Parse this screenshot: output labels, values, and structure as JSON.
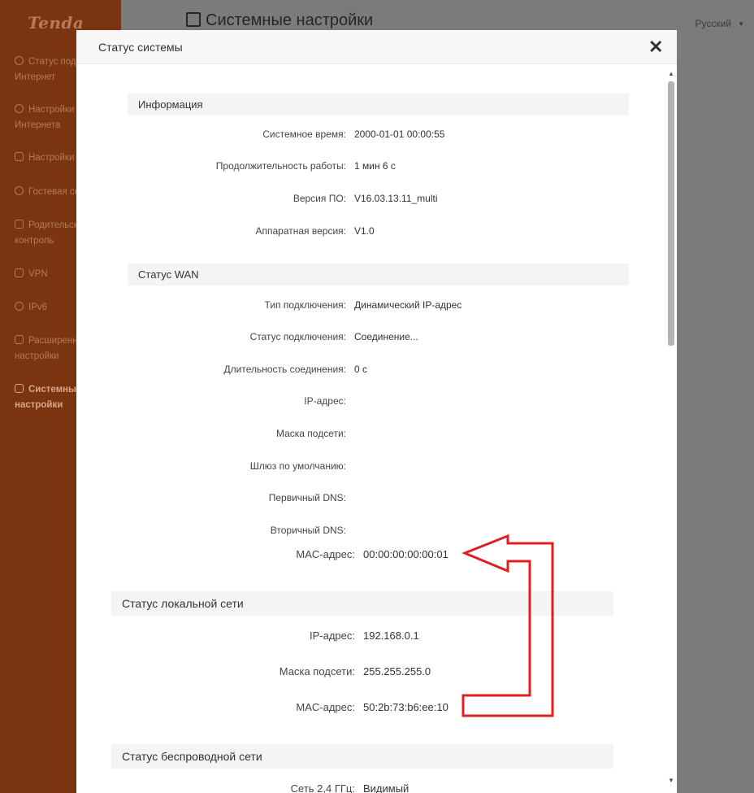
{
  "app": {
    "logo": "Tenda",
    "page_title": "Системные настройки",
    "language": "Русский"
  },
  "sidebar": {
    "items": [
      {
        "label_line1": "Статус подключения",
        "label_line2": "Интернет"
      },
      {
        "label_line1": "Настройки",
        "label_line2": "Интернета"
      },
      {
        "label_line1": "Настройки Wi-Fi",
        "label_line2": ""
      },
      {
        "label_line1": "Гостевая сеть",
        "label_line2": ""
      },
      {
        "label_line1": "Родительский",
        "label_line2": "контроль"
      },
      {
        "label_line1": "VPN",
        "label_line2": ""
      },
      {
        "label_line1": "IPv6",
        "label_line2": ""
      },
      {
        "label_line1": "Расширенные",
        "label_line2": "настройки"
      },
      {
        "label_line1": "Системные",
        "label_line2": "настройки"
      }
    ]
  },
  "modal": {
    "title": "Статус системы",
    "close_label": "✕",
    "info": {
      "header": "Информация",
      "rows": [
        {
          "label": "Системное время:",
          "value": "2000-01-01 00:00:55"
        },
        {
          "label": "Продолжительность работы:",
          "value": "1 мин 6 с"
        },
        {
          "label": "Версия ПО:",
          "value": "V16.03.13.11_multi"
        },
        {
          "label": "Аппаратная версия:",
          "value": "V1.0"
        }
      ]
    },
    "wan": {
      "header": "Статус WAN",
      "rows": [
        {
          "label": "Тип подключения:",
          "value": "Динамический IP-адрес"
        },
        {
          "label": "Статус подключения:",
          "value": "Соединение..."
        },
        {
          "label": "Длительность соединения:",
          "value": "0 с"
        },
        {
          "label": "IP-адрес:",
          "value": ""
        },
        {
          "label": "Маска подсети:",
          "value": ""
        },
        {
          "label": "Шлюз по умолчанию:",
          "value": ""
        },
        {
          "label": "Первичный DNS:",
          "value": ""
        },
        {
          "label": "Вторичный DNS:",
          "value": ""
        },
        {
          "label": "MAC-адрес:",
          "value": "00:00:00:00:00:01"
        }
      ]
    },
    "lan": {
      "header": "Статус локальной сети",
      "rows": [
        {
          "label": "IP-адрес:",
          "value": "192.168.0.1"
        },
        {
          "label": "Маска подсети:",
          "value": "255.255.255.0"
        },
        {
          "label": "MAC-адрес:",
          "value": "50:2b:73:b6:ee:10"
        }
      ]
    },
    "wireless": {
      "header": "Статус беспроводной сети",
      "rows": [
        {
          "label": "Сеть 2,4 ГГц:",
          "value": "Видимый"
        }
      ]
    }
  },
  "annotation": {
    "color": "#e02020"
  }
}
